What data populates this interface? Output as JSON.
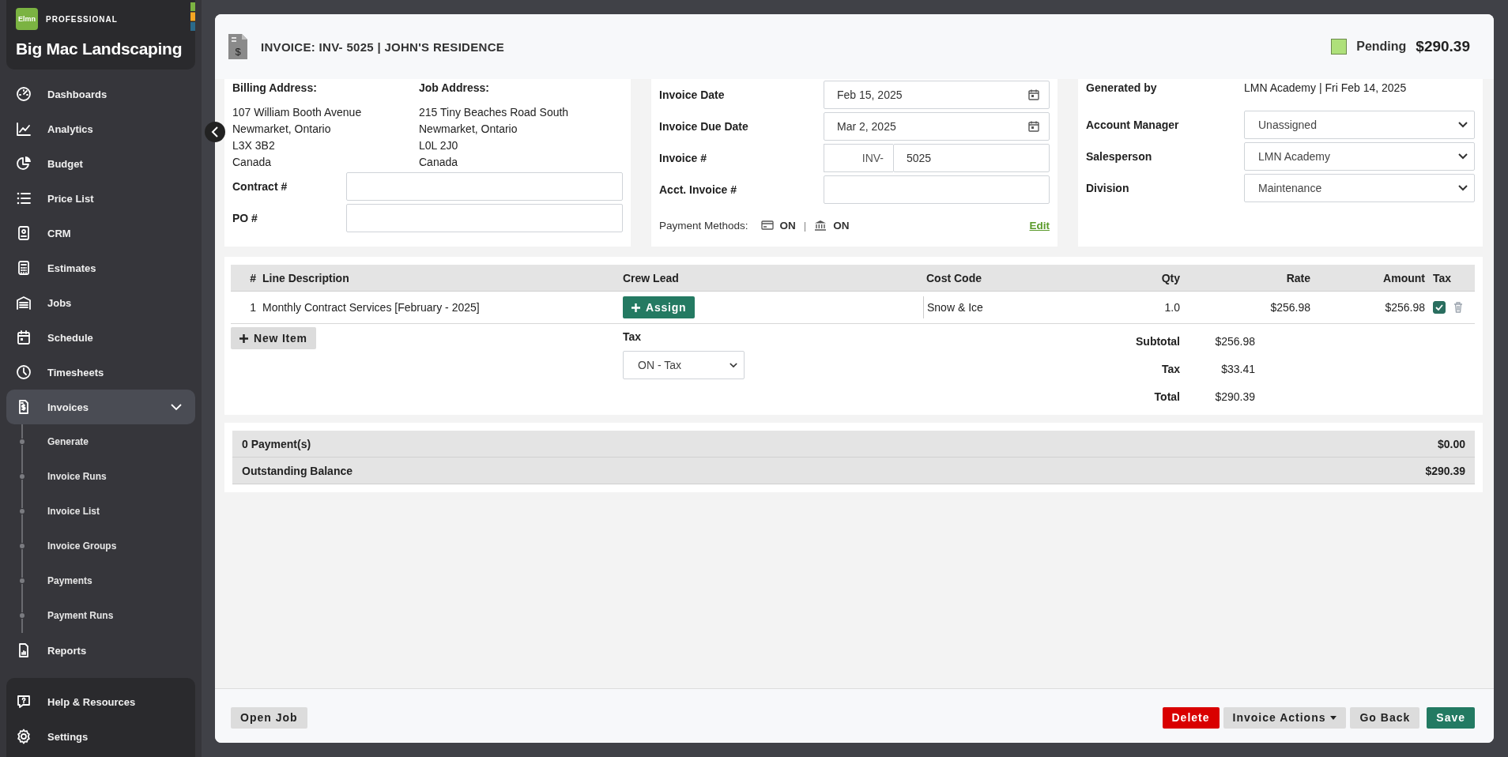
{
  "sidebar": {
    "badge": "PROFESSIONAL",
    "logo": "Elmn",
    "company": "Big Mac Landscaping",
    "items": [
      {
        "label": "Dashboards",
        "selected": false
      },
      {
        "label": "Analytics",
        "selected": false
      },
      {
        "label": "Budget",
        "selected": false
      },
      {
        "label": "Price List",
        "selected": false
      },
      {
        "label": "CRM",
        "selected": false
      },
      {
        "label": "Estimates",
        "selected": false
      },
      {
        "label": "Jobs",
        "selected": false
      },
      {
        "label": "Schedule",
        "selected": false
      },
      {
        "label": "Timesheets",
        "selected": false
      },
      {
        "label": "Invoices",
        "selected": true,
        "expanded": true,
        "children": [
          {
            "label": "Generate",
            "selected": false
          },
          {
            "label": "Invoice Runs",
            "selected": false
          },
          {
            "label": "Invoice List",
            "selected": false
          },
          {
            "label": "Invoice Groups",
            "selected": false
          },
          {
            "label": "Payments",
            "selected": false
          },
          {
            "label": "Payment Runs",
            "selected": false
          }
        ]
      },
      {
        "label": "Reports",
        "selected": false
      }
    ],
    "footer_items": [
      {
        "label": "Help & Resources"
      },
      {
        "label": "Settings"
      }
    ]
  },
  "header": {
    "icon_symbol": "$",
    "title": "INVOICE: INV- 5025 | JOHN'S RESIDENCE",
    "status": {
      "label": "Pending",
      "color": "#aee07a"
    },
    "total": "$290.39"
  },
  "addresses": [
    {
      "label": "Billing Address:",
      "lines": [
        "107 William Booth Avenue",
        "Newmarket, Ontario",
        "L3X 3B2",
        "Canada"
      ]
    },
    {
      "label": "Job Address:",
      "lines": [
        "215 Tiny Beaches Road South",
        "Newmarket, Ontario",
        "L0L 2J0",
        "Canada"
      ]
    }
  ],
  "reference_fields": [
    {
      "label": "Contract #"
    },
    {
      "label": "PO #"
    }
  ],
  "invoice_fields": [
    {
      "label": "Invoice Date",
      "kind": "date",
      "value": "Feb 15, 2025"
    },
    {
      "label": "Invoice Due Date",
      "kind": "date",
      "value": "Mar 2, 2025"
    },
    {
      "label": "Invoice #",
      "kind": "prefixed",
      "prefix": "INV-",
      "value": "5025"
    },
    {
      "label": "Acct. Invoice #",
      "kind": "text"
    }
  ],
  "payment_methods": {
    "label": "Payment Methods:",
    "methods": [
      {
        "status": "ON"
      },
      {
        "status": "ON"
      }
    ],
    "separator": "|",
    "edit": "Edit"
  },
  "generated_by": {
    "label": "Generated by",
    "value": "LMN Academy | Fri Feb 14, 2025"
  },
  "assignments": [
    {
      "label": "Account Manager",
      "value": "Unassigned"
    },
    {
      "label": "Salesperson",
      "value": "LMN Academy"
    },
    {
      "label": "Division",
      "value": "Maintenance"
    }
  ],
  "table": {
    "columns": [
      "#",
      "Line Description",
      "Crew Lead",
      "Cost Code",
      "Qty",
      "Rate",
      "Amount",
      "Tax"
    ],
    "rows": [
      {
        "number": "1",
        "description": "Monthly Contract Services [February - 2025]",
        "crew_button": "Assign",
        "cost_code": "Snow & Ice",
        "qty": "1.0",
        "rate": "$256.98",
        "amount": "$256.98",
        "taxable": true
      }
    ]
  },
  "new_item": "New Item",
  "tax_select": {
    "label": "Tax",
    "value": "ON - Tax"
  },
  "totals": [
    {
      "label": "Subtotal",
      "value": "$256.98"
    },
    {
      "label": "Tax",
      "value": "$33.41"
    },
    {
      "label": "Total",
      "value": "$290.39"
    }
  ],
  "payments": [
    {
      "label": "0 Payment(s)",
      "value": "$0.00"
    },
    {
      "label": "Outstanding Balance",
      "value": "$290.39"
    }
  ],
  "footer": {
    "left_button": "Open Job",
    "buttons": [
      {
        "label": "Delete",
        "kind": "danger"
      },
      {
        "label": "Invoice Actions",
        "kind": "dropdown"
      },
      {
        "label": "Go Back",
        "kind": "default"
      },
      {
        "label": "Save",
        "kind": "primary"
      }
    ]
  }
}
